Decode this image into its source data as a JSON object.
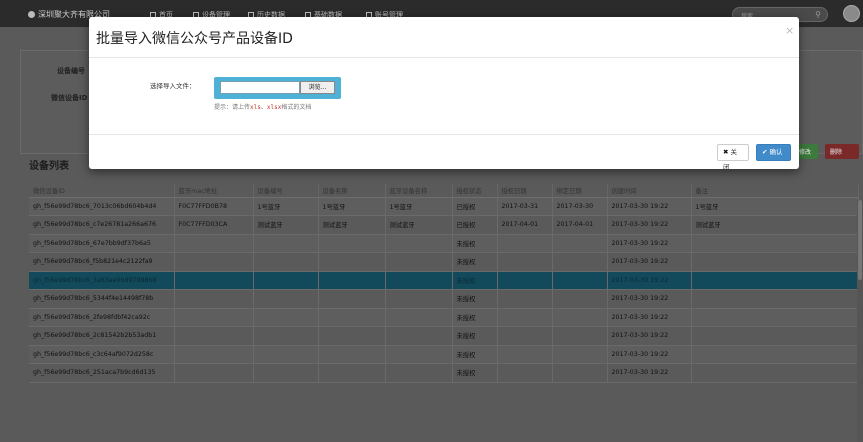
{
  "navbar": {
    "brand": "深圳聚大齐有限公司",
    "items": [
      "首页",
      "设备管理",
      "历史数据",
      "基础数据",
      "账号管理"
    ],
    "search_placeholder": "搜索"
  },
  "form": {
    "label_device_no": "设备编号",
    "label_wx_device_id": "微信设备ID"
  },
  "section_title": "设备列表",
  "side_buttons": {
    "green": "修改",
    "red": "删除"
  },
  "table": {
    "headers": [
      "微信设备ID",
      "蓝牙mac地址",
      "设备编号",
      "设备名称",
      "蓝牙设备名称",
      "授权状态",
      "授权日期",
      "绑定日期",
      "创建时间",
      "备注"
    ],
    "rows": [
      [
        "gh_f56e99d78bc6_7013c06bd604b4d4",
        "F0C77FFD0B78",
        "1号蓝牙",
        "1号蓝牙",
        "1号蓝牙",
        "已授权",
        "2017-03-31",
        "2017-03-30",
        "2017-03-30 19:22",
        "1号蓝牙"
      ],
      [
        "gh_f56e99d78bc6_c7e26781a266a676",
        "F0C77FFD03CA",
        "测试蓝牙",
        "测试蓝牙",
        "测试蓝牙",
        "已授权",
        "2017-04-01",
        "2017-04-01",
        "2017-03-30 19:22",
        "测试蓝牙"
      ],
      [
        "gh_f56e99d78bc6_67e7bb9df37b6a5",
        "",
        "",
        "",
        "",
        "未授权",
        "",
        "",
        "2017-03-30 19:22",
        ""
      ],
      [
        "gh_f56e99d78bc6_f5b821e4c2122fa9",
        "",
        "",
        "",
        "",
        "未授权",
        "",
        "",
        "2017-03-30 19:22",
        ""
      ],
      [
        "gh_f56e99d78bc6_3a63ae9b997988b8",
        "",
        "",
        "",
        "",
        "未授权",
        "",
        "",
        "2017-03-30 19:22",
        ""
      ],
      [
        "gh_f56e99d78bc6_5344f4e14498f78b",
        "",
        "",
        "",
        "",
        "未授权",
        "",
        "",
        "2017-03-30 19:22",
        ""
      ],
      [
        "gh_f56e99d78bc6_2fe98fdbf42ca92c",
        "",
        "",
        "",
        "",
        "未授权",
        "",
        "",
        "2017-03-30 19:22",
        ""
      ],
      [
        "gh_f56e99d78bc6_2c81542b2b53adb1",
        "",
        "",
        "",
        "",
        "未授权",
        "",
        "",
        "2017-03-30 19:22",
        ""
      ],
      [
        "gh_f56e99d78bc6_c3c64af9072d258c",
        "",
        "",
        "",
        "",
        "未授权",
        "",
        "",
        "2017-03-30 19:22",
        ""
      ],
      [
        "gh_f56e99d78bc6_251aca7b9cd6d135",
        "",
        "",
        "",
        "",
        "未授权",
        "",
        "",
        "2017-03-30 19:22",
        ""
      ]
    ],
    "selected_row": 4
  },
  "modal": {
    "title": "批量导入微信公众号产品设备ID",
    "close_symbol": "×",
    "file_label": "选择导入文件：",
    "browse_label": "浏览...",
    "hint_prefix": "提示：请上传",
    "hint_ext1": "xls",
    "hint_sep": "、",
    "hint_ext2": "xlsx",
    "hint_suffix": "格式的文档",
    "btn_close": "关闭",
    "btn_ok": "确认"
  },
  "colors": {
    "accent": "#428bca",
    "file_box": "#4fb1d6",
    "selected_row": "#124a5c"
  }
}
